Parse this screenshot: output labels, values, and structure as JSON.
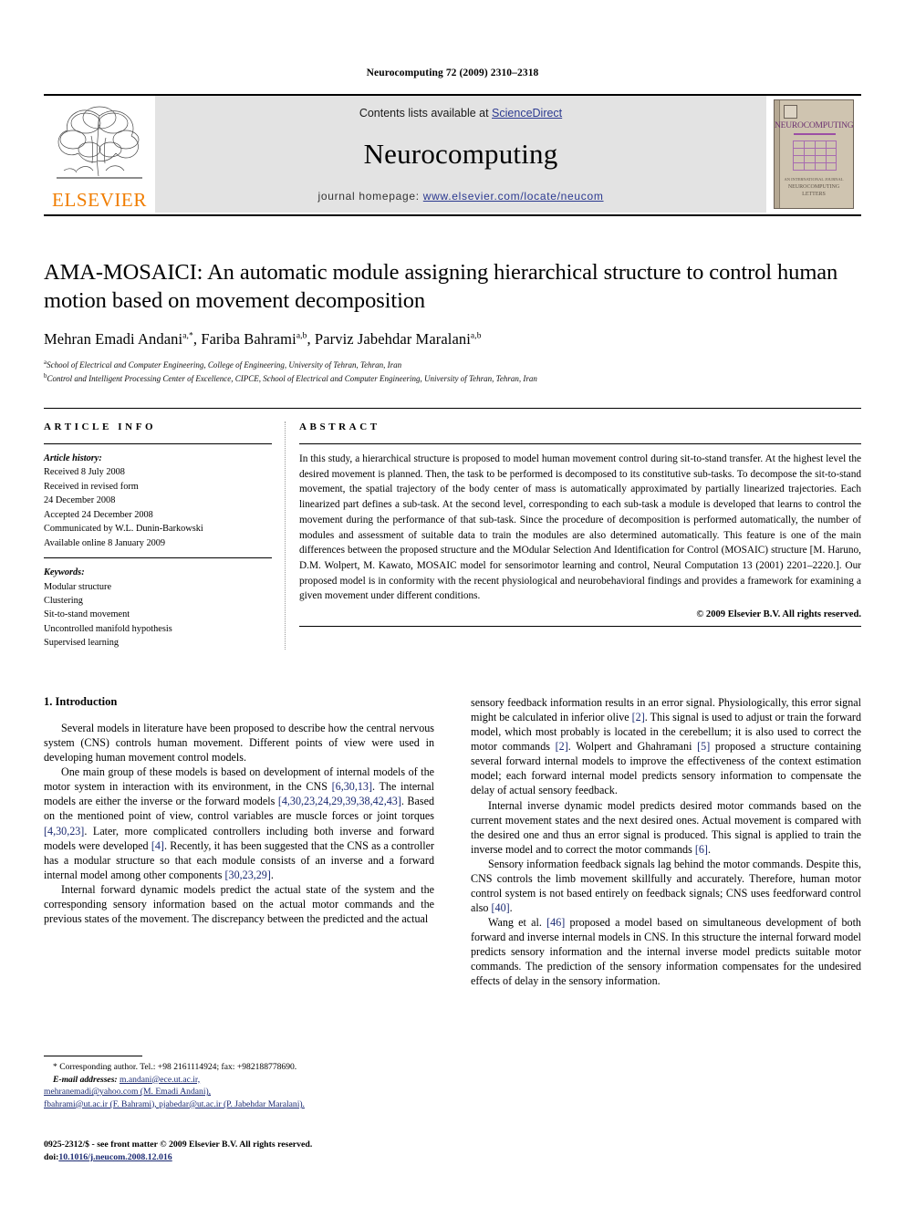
{
  "running_head": "Neurocomputing 72 (2009) 2310–2318",
  "masthead": {
    "publisher_logo_text": "ELSEVIER",
    "contents_prefix": "Contents lists available at ",
    "contents_link": "ScienceDirect",
    "journal_name": "Neurocomputing",
    "homepage_prefix": "journal homepage: ",
    "homepage_url": "www.elsevier.com/locate/neucom",
    "cover": {
      "title": "NEUROCOMPUTING",
      "footer_small": "AN INTERNATIONAL JOURNAL",
      "footer_line1": "NEUROCOMPUTING",
      "footer_line2": "LETTERS"
    },
    "link_color": "#2b3990",
    "band_color": "#e3e3e3",
    "elsevier_orange": "#F07D00"
  },
  "article": {
    "title": "AMA-MOSAICI: An automatic module assigning hierarchical structure to control human motion based on movement decomposition",
    "authors_html": "Mehran Emadi Andani",
    "authors": [
      {
        "name": "Mehran Emadi Andani",
        "marks": "a,*"
      },
      {
        "name": "Fariba Bahrami",
        "marks": "a,b"
      },
      {
        "name": "Parviz Jabehdar Maralani",
        "marks": "a,b"
      }
    ],
    "affiliations": [
      {
        "mark": "a",
        "text": "School of Electrical and Computer Engineering, College of Engineering, University of Tehran, Tehran, Iran"
      },
      {
        "mark": "b",
        "text": "Control and Intelligent Processing Center of Excellence, CIPCE, School of Electrical and Computer Engineering, University of Tehran, Tehran, Iran"
      }
    ]
  },
  "info": {
    "heading": "ARTICLE INFO",
    "history_label": "Article history:",
    "history": [
      "Received 8 July 2008",
      "Received in revised form",
      "24 December 2008",
      "Accepted 24 December 2008",
      "Communicated by W.L. Dunin-Barkowski",
      "Available online 8 January 2009"
    ],
    "keywords_label": "Keywords:",
    "keywords": [
      "Modular structure",
      "Clustering",
      "Sit-to-stand movement",
      "Uncontrolled manifold hypothesis",
      "Supervised learning"
    ]
  },
  "abstract": {
    "heading": "ABSTRACT",
    "text": "In this study, a hierarchical structure is proposed to model human movement control during sit-to-stand transfer. At the highest level the desired movement is planned. Then, the task to be performed is decomposed to its constitutive sub-tasks. To decompose the sit-to-stand movement, the spatial trajectory of the body center of mass is automatically approximated by partially linearized trajectories. Each linearized part defines a sub-task. At the second level, corresponding to each sub-task a module is developed that learns to control the movement during the performance of that sub-task. Since the procedure of decomposition is performed automatically, the number of modules and assessment of suitable data to train the modules are also determined automatically. This feature is one of the main differences between the proposed structure and the MOdular Selection And Identification for Control (MOSAIC) structure [M. Haruno, D.M. Wolpert, M. Kawato, MOSAIC model for sensorimotor learning and control, Neural Computation 13 (2001) 2201–2220.]. Our proposed model is in conformity with the recent physiological and neurobehavioral findings and provides a framework for examining a given movement under different conditions.",
    "copyright": "© 2009 Elsevier B.V. All rights reserved."
  },
  "body": {
    "section_number_title": "1. Introduction",
    "left_paragraphs": [
      "Several models in literature have been proposed to describe how the central nervous system (CNS) controls human movement. Different points of view were used in developing human movement control models.",
      "One main group of these models is based on development of internal models of the motor system in interaction with its environment, in the CNS [6,30,13]. The internal models are either the inverse or the forward models [4,30,23,24,29,39,38,42,43]. Based on the mentioned point of view, control variables are muscle forces or joint torques [4,30,23]. Later, more complicated controllers including both inverse and forward models were developed [4]. Recently, it has been suggested that the CNS as a controller has a modular structure so that each module consists of an inverse and a forward internal model among other components [30,23,29].",
      "Internal forward dynamic models predict the actual state of the system and the corresponding sensory information based on the actual motor commands and the previous states of the movement. The discrepancy between the predicted and the actual"
    ],
    "right_paragraphs": [
      "sensory feedback information results in an error signal. Physiologically, this error signal might be calculated in inferior olive [2]. This signal is used to adjust or train the forward model, which most probably is located in the cerebellum; it is also used to correct the motor commands [2]. Wolpert and Ghahramani [5] proposed a structure containing several forward internal models to improve the effectiveness of the context estimation model; each forward internal model predicts sensory information to compensate the delay of actual sensory feedback.",
      "Internal inverse dynamic model predicts desired motor commands based on the current movement states and the next desired ones. Actual movement is compared with the desired one and thus an error signal is produced. This signal is applied to train the inverse model and to correct the motor commands [6].",
      "Sensory information feedback signals lag behind the motor commands. Despite this, CNS controls the limb movement skillfully and accurately. Therefore, human motor control system is not based entirely on feedback signals; CNS uses feedforward control also [40].",
      "Wang et al. [46] proposed a model based on simultaneous development of both forward and inverse internal models in CNS. In this structure the internal forward model predicts sensory information and the internal inverse model predicts suitable motor commands. The prediction of the sensory information compensates for the undesired effects of delay in the sensory information."
    ]
  },
  "footnotes": {
    "corresponding": "* Corresponding author. Tel.: +98 2161114924; fax: +982188778690.",
    "email_label": "E-mail addresses:",
    "emails_line1": "m.andani@ece.ut.ac.ir,",
    "emails_line2": "mehranemadi@yahoo.com (M. Emadi Andani),",
    "emails_line3": "fbahrami@ut.ac.ir (F. Bahrami), pjabedar@ut.ac.ir (P. Jabehdar Maralani)."
  },
  "imprint": {
    "line1": "0925-2312/$ - see front matter © 2009 Elsevier B.V. All rights reserved.",
    "doi_label": "doi:",
    "doi_value": "10.1016/j.neucom.2008.12.016"
  },
  "colors": {
    "reference_blue": "#1b2a72",
    "link_blue": "#2b3990"
  }
}
